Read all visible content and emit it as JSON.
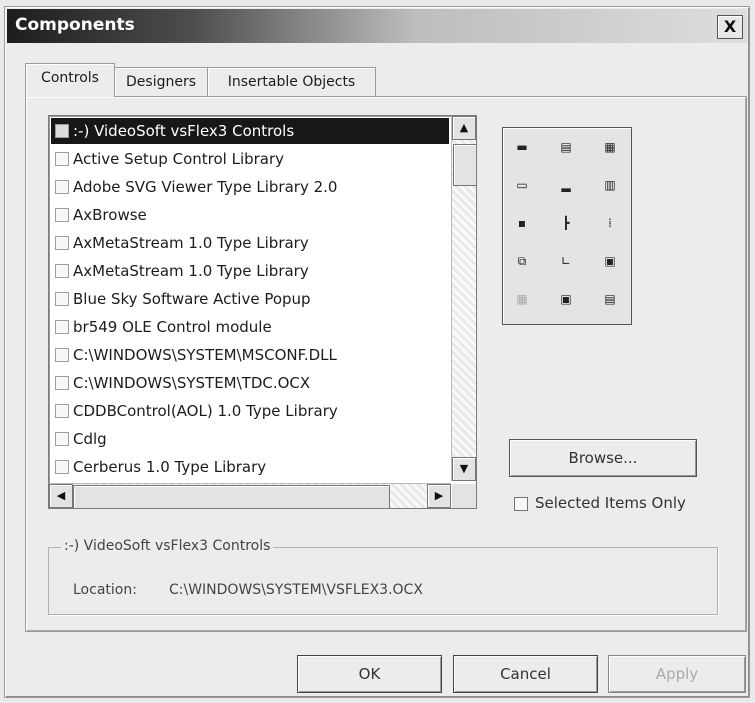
{
  "dialog": {
    "title": "Components",
    "close_glyph": "X",
    "tabs": [
      {
        "label": "Controls",
        "active": true
      },
      {
        "label": "Designers",
        "active": false
      },
      {
        "label": "Insertable Objects",
        "active": false
      }
    ],
    "list": {
      "items": [
        {
          "label": ":-) VideoSoft vsFlex3 Controls",
          "checked": false,
          "selected": true
        },
        {
          "label": "Active Setup Control Library",
          "checked": false,
          "selected": false
        },
        {
          "label": "Adobe SVG Viewer Type Library 2.0",
          "checked": false,
          "selected": false
        },
        {
          "label": "AxBrowse",
          "checked": false,
          "selected": false
        },
        {
          "label": "AxMetaStream 1.0 Type Library",
          "checked": false,
          "selected": false
        },
        {
          "label": "AxMetaStream 1.0 Type Library",
          "checked": false,
          "selected": false
        },
        {
          "label": "Blue Sky Software Active Popup",
          "checked": false,
          "selected": false
        },
        {
          "label": "br549 OLE Control module",
          "checked": false,
          "selected": false
        },
        {
          "label": "C:\\WINDOWS\\SYSTEM\\MSCONF.DLL",
          "checked": false,
          "selected": false
        },
        {
          "label": "C:\\WINDOWS\\SYSTEM\\TDC.OCX",
          "checked": false,
          "selected": false
        },
        {
          "label": "CDDBControl(AOL) 1.0 Type Library",
          "checked": false,
          "selected": false
        },
        {
          "label": "Cdlg",
          "checked": false,
          "selected": false
        },
        {
          "label": "Cerberus 1.0 Type Library",
          "checked": false,
          "selected": false
        }
      ],
      "scroll_up_icon": "arrow-up-icon",
      "scroll_down_icon": "arrow-down-icon",
      "scroll_left_icon": "arrow-left-icon",
      "scroll_right_icon": "arrow-right-icon"
    },
    "toolbox_palette": {
      "icons": [
        "picture-icon",
        "frame-icon",
        "ole-icon",
        "textbox-icon",
        "chart-icon",
        "grid-icon",
        "scrollbar-icon",
        "treeview-icon",
        "listview-icon",
        "tabstrip-icon",
        "graph-icon",
        "toolbar-icon",
        "grid-disabled-icon",
        "image-icon",
        "datetime-icon"
      ]
    },
    "browse_button": "Browse...",
    "selected_items_only": {
      "label": "Selected Items Only",
      "checked": false
    },
    "details": {
      "group_title": ":-) VideoSoft vsFlex3 Controls",
      "location_label": "Location:",
      "location_value": "C:\\WINDOWS\\SYSTEM\\VSFLEX3.OCX"
    },
    "buttons": {
      "ok": "OK",
      "cancel": "Cancel",
      "apply": "Apply",
      "apply_enabled": false
    }
  }
}
